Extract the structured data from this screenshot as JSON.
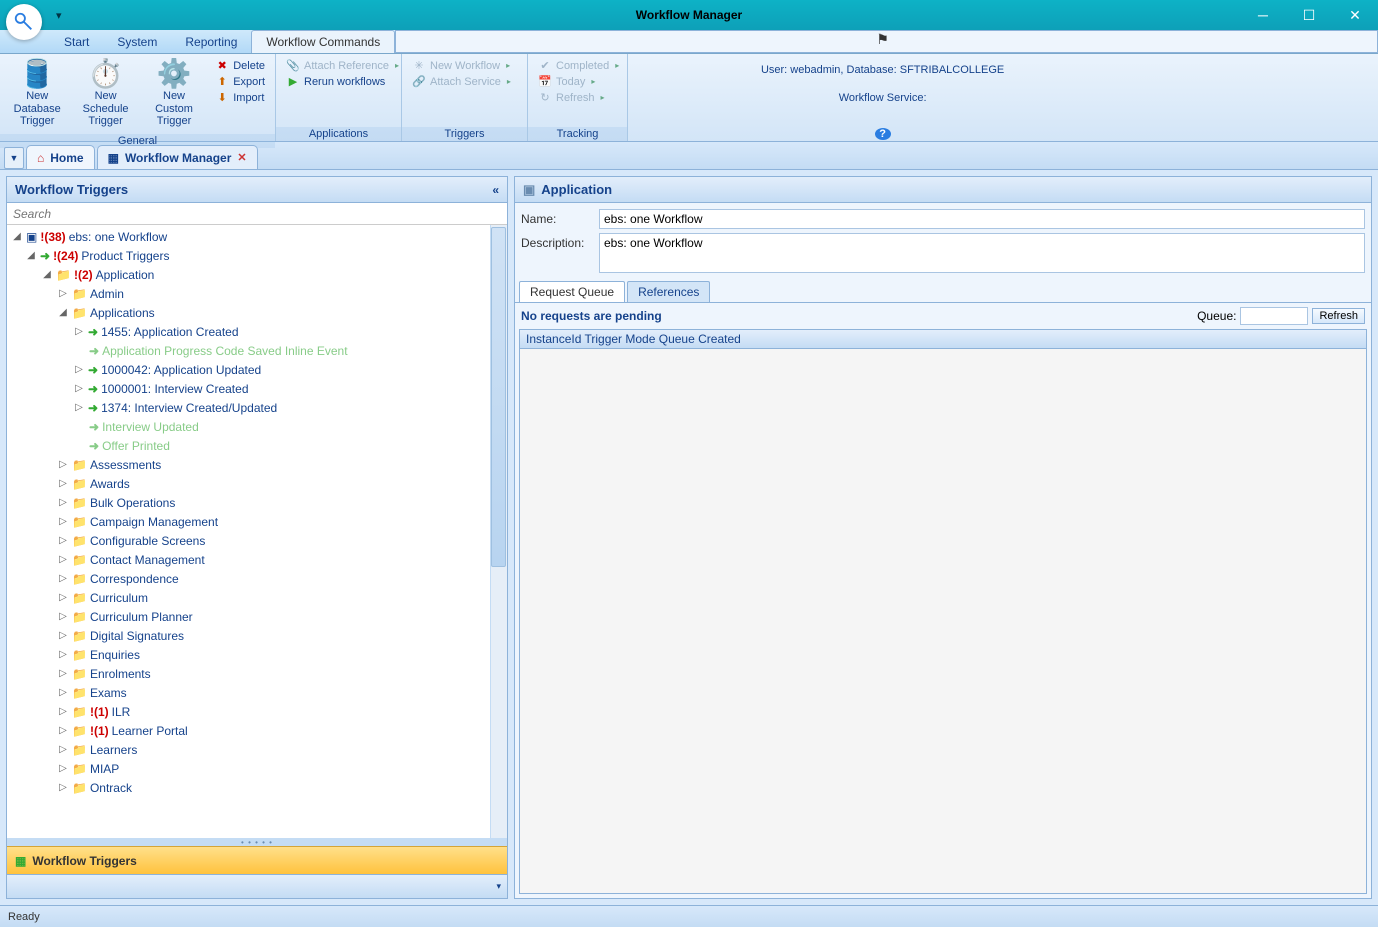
{
  "window": {
    "title": "Workflow Manager"
  },
  "menu": {
    "tabs": [
      "Start",
      "System",
      "Reporting",
      "Workflow Commands"
    ],
    "active": 3,
    "userinfo": "User: webadmin, Database: SFTRIBALCOLLEGE",
    "service_label": "Workflow Service:",
    "service_color": "#3c3"
  },
  "ribbon": {
    "general": {
      "label": "General",
      "big": [
        {
          "icon": "🛢️",
          "line1": "New Database",
          "line2": "Trigger"
        },
        {
          "icon": "⏱️",
          "line1": "New Schedule",
          "line2": "Trigger"
        },
        {
          "icon": "⚙️",
          "line1": "New Custom",
          "line2": "Trigger"
        }
      ],
      "small": [
        {
          "icon": "✖",
          "text": "Delete",
          "color": "#c00"
        },
        {
          "icon": "📤",
          "text": "Export",
          "color": "#c60"
        },
        {
          "icon": "📥",
          "text": "Import",
          "color": "#c60"
        }
      ]
    },
    "applications": {
      "label": "Applications",
      "items": [
        {
          "text": "Attach Reference",
          "dis": true,
          "arrow": true
        },
        {
          "text": "Rerun workflows",
          "dis": false,
          "arrow": false
        }
      ]
    },
    "triggers": {
      "label": "Triggers",
      "items": [
        {
          "text": "New Workflow",
          "dis": true,
          "arrow": true,
          "icon": "✳"
        },
        {
          "text": "Attach Service",
          "dis": true,
          "arrow": true,
          "icon": "🔗"
        }
      ]
    },
    "tracking": {
      "label": "Tracking",
      "items": [
        {
          "text": "Completed",
          "dis": true,
          "arrow": true,
          "icon": "✔"
        },
        {
          "text": "Today",
          "dis": true,
          "arrow": true,
          "icon": "📅"
        },
        {
          "text": "Refresh",
          "dis": true,
          "arrow": true,
          "icon": "↻"
        }
      ]
    }
  },
  "doctabs": {
    "home": "Home",
    "wm": "Workflow Manager"
  },
  "leftpanel": {
    "title": "Workflow Triggers",
    "search_ph": "Search",
    "foot": "Workflow Triggers",
    "root": {
      "badge": "!(38)",
      "label": "ebs: one Workflow"
    },
    "product": {
      "badge": "!(24)",
      "label": "Product Triggers"
    },
    "app": {
      "badge": "!(2)",
      "label": "Application"
    },
    "admin": "Admin",
    "applications": "Applications",
    "appkids": [
      {
        "t": "1455: Application Created",
        "a": true
      },
      {
        "t": "Application Progress Code Saved Inline Event",
        "a": false
      },
      {
        "t": "1000042: Application Updated",
        "a": true
      },
      {
        "t": "1000001: Interview Created",
        "a": true
      },
      {
        "t": "1374: Interview Created/Updated",
        "a": true
      },
      {
        "t": "Interview Updated",
        "a": false
      },
      {
        "t": "Offer Printed",
        "a": false
      }
    ],
    "folders": [
      "Assessments",
      "Awards",
      "Bulk Operations",
      "Campaign Management",
      "Configurable Screens",
      "Contact Management",
      "Correspondence",
      "Curriculum",
      "Curriculum Planner",
      "Digital Signatures",
      "Enquiries",
      "Enrolments",
      "Exams",
      {
        "badge": "!(1)",
        "label": "ILR"
      },
      {
        "badge": "!(1)",
        "label": "Learner Portal"
      },
      "Learners",
      "MIAP",
      "Ontrack"
    ]
  },
  "rightpanel": {
    "title": "Application",
    "name_lbl": "Name:",
    "name_val": "ebs: one Workflow",
    "desc_lbl": "Description:",
    "desc_val": "ebs: one Workflow",
    "tabs": [
      "Request Queue",
      "References"
    ],
    "pending": "No requests are pending",
    "queue_lbl": "Queue:",
    "refresh": "Refresh",
    "cols": "InstanceId Trigger Mode Queue Created"
  },
  "status": "Ready"
}
